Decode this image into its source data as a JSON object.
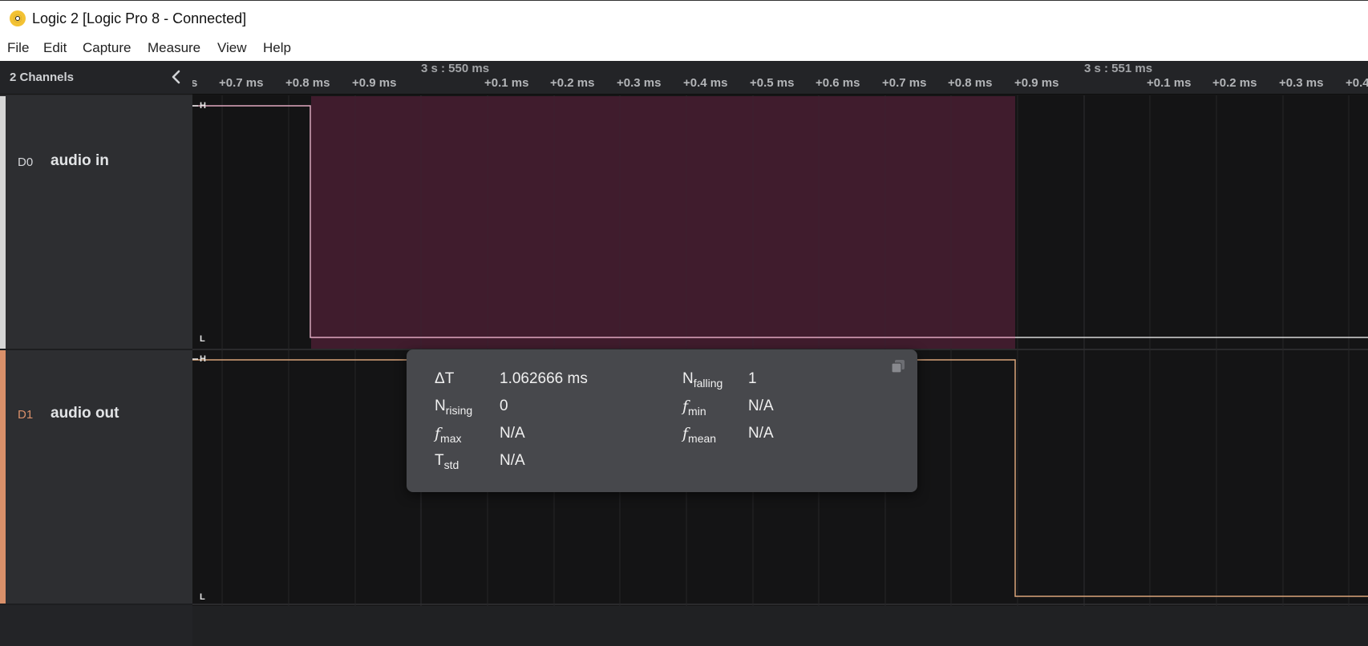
{
  "window": {
    "title": "Logic 2 [Logic Pro 8 - Connected]"
  },
  "menu": [
    "File",
    "Edit",
    "Capture",
    "Measure",
    "View",
    "Help"
  ],
  "sidebar": {
    "header": "2 Channels",
    "channels": [
      {
        "id": "D0",
        "name": "audio in",
        "color": "#d6d6d6",
        "id_color": "#d3d5d8"
      },
      {
        "id": "D1",
        "name": "audio out",
        "color": "#d9906a",
        "id_color": "#d9906a"
      }
    ]
  },
  "timeline": {
    "major_labels": [
      "3 s : 550 ms",
      "3 s : 551 ms"
    ],
    "ticks": [
      "s",
      "+0.7 ms",
      "+0.8 ms",
      "+0.9 ms",
      "+0.1 ms",
      "+0.2 ms",
      "+0.3 ms",
      "+0.4 ms",
      "+0.5 ms",
      "+0.6 ms",
      "+0.7 ms",
      "+0.8 ms",
      "+0.9 ms",
      "+0.1 ms",
      "+0.2 ms",
      "+0.3 ms",
      "+0.4"
    ]
  },
  "levels": {
    "high": "H",
    "low": "L"
  },
  "measurement": {
    "delta_t": {
      "label": "ΔT",
      "value": "1.062666 ms"
    },
    "n_falling": {
      "label": "N",
      "sub": "falling",
      "value": "1"
    },
    "n_rising": {
      "label": "N",
      "sub": "rising",
      "value": "0"
    },
    "f_min": {
      "label": "f",
      "sub": "min",
      "value": "N/A"
    },
    "f_max": {
      "label": "f",
      "sub": "max",
      "value": "N/A"
    },
    "f_mean": {
      "label": "f",
      "sub": "mean",
      "value": "N/A"
    },
    "t_std": {
      "label": "T",
      "sub": "std",
      "value": "N/A"
    }
  },
  "colors": {
    "selection": "#401c2d",
    "d0_trace": "#e0a8c0",
    "d1_trace": "#d9a47a",
    "accent_d1": "#d9906a"
  }
}
